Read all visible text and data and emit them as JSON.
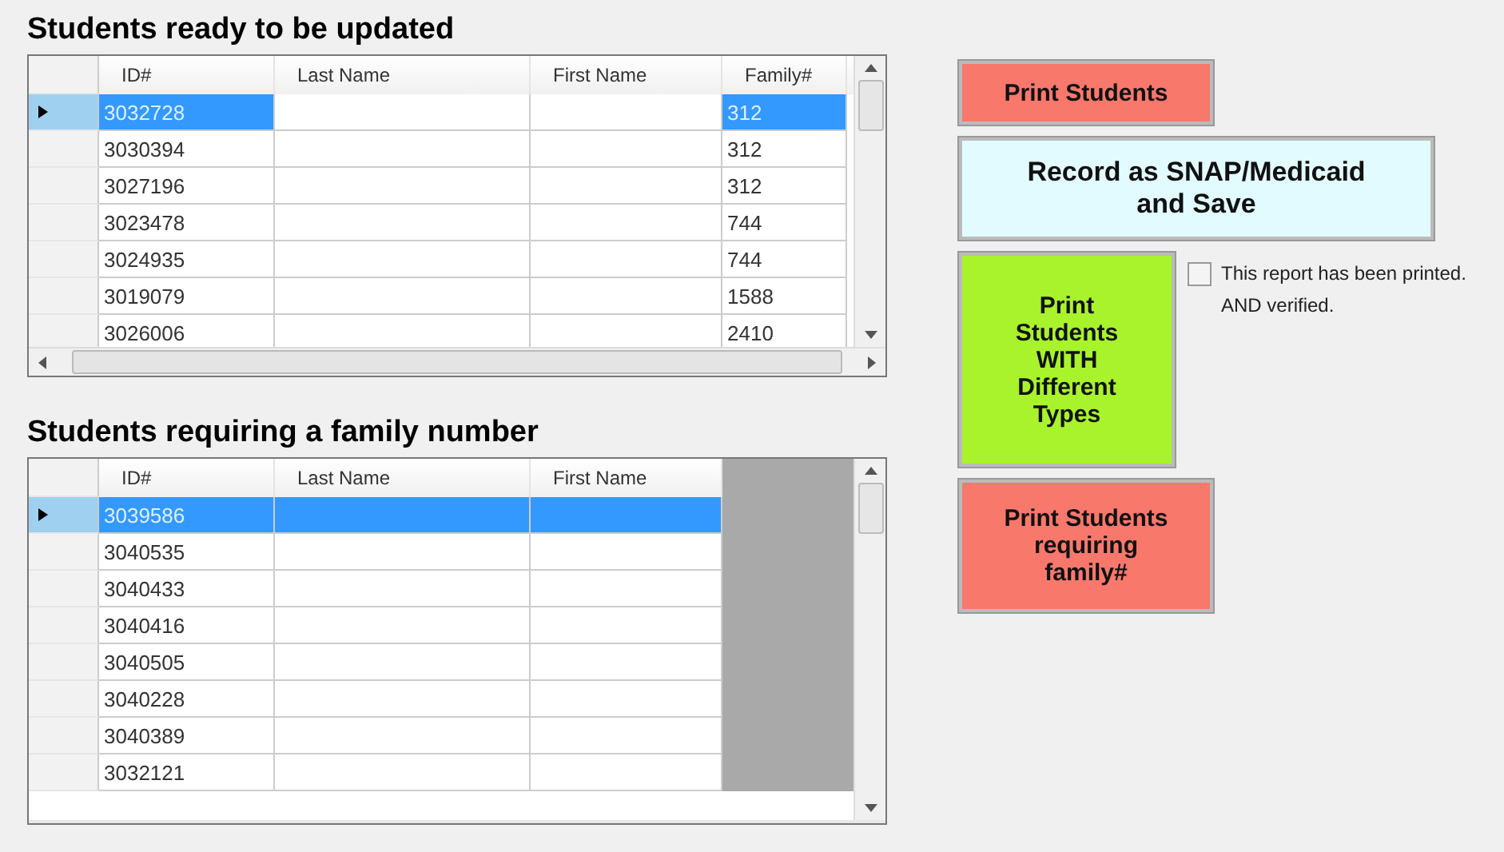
{
  "grids": [
    {
      "title": "Students ready to be updated",
      "columns": [
        "ID#",
        "Last Name",
        "First Name",
        "Family#"
      ],
      "rows": [
        {
          "selected": true,
          "cells": [
            "3032728",
            "",
            "",
            "312"
          ]
        },
        {
          "selected": false,
          "cells": [
            "3030394",
            "",
            "",
            "312"
          ]
        },
        {
          "selected": false,
          "cells": [
            "3027196",
            "",
            "",
            "312"
          ]
        },
        {
          "selected": false,
          "cells": [
            "3023478",
            "",
            "",
            "744"
          ]
        },
        {
          "selected": false,
          "cells": [
            "3024935",
            "",
            "",
            "744"
          ]
        },
        {
          "selected": false,
          "cells": [
            "3019079",
            "",
            "",
            "1588"
          ]
        },
        {
          "selected": false,
          "cells": [
            "3026006",
            "",
            "",
            "2410"
          ]
        }
      ],
      "hscroll": true
    },
    {
      "title": "Students requiring a family number",
      "columns": [
        "ID#",
        "Last Name",
        "First Name"
      ],
      "rows": [
        {
          "selected": true,
          "cells": [
            "3039586",
            "",
            ""
          ]
        },
        {
          "selected": false,
          "cells": [
            "3040535",
            "",
            ""
          ]
        },
        {
          "selected": false,
          "cells": [
            "3040433",
            "",
            ""
          ]
        },
        {
          "selected": false,
          "cells": [
            "3040416",
            "",
            ""
          ]
        },
        {
          "selected": false,
          "cells": [
            "3040505",
            "",
            ""
          ]
        },
        {
          "selected": false,
          "cells": [
            "3040228",
            "",
            ""
          ]
        },
        {
          "selected": false,
          "cells": [
            "3040389",
            "",
            ""
          ]
        },
        {
          "selected": false,
          "cells": [
            "3032121",
            "",
            ""
          ]
        }
      ],
      "hscroll": false
    }
  ],
  "buttons": [
    {
      "label": "Print Students",
      "color": "#f8786c",
      "kind": "short"
    },
    {
      "label": "Record as SNAP/Medicaid and Save",
      "color": "#e2fbff",
      "kind": "wide"
    },
    {
      "label": "Print Students WITH Different Types",
      "color": "#a8f32c",
      "kind": "tall"
    },
    {
      "label": "Print Students requiring family#",
      "color": "#f8786c",
      "kind": "short"
    }
  ],
  "checkbox": {
    "checked": false,
    "label_lines": [
      "This report has been printed.",
      "AND verified."
    ]
  }
}
